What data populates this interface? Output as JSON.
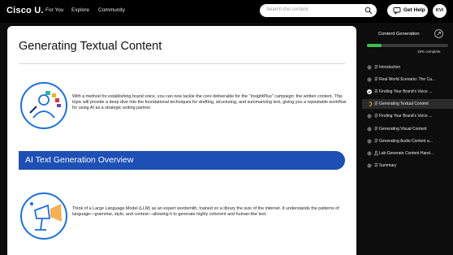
{
  "header": {
    "logo": {
      "brand": "Cisco",
      "suffix": "U."
    },
    "nav": [
      "For You",
      "Explore",
      "Community"
    ],
    "search_placeholder": "Search this content",
    "help_label": "Get Help",
    "avatar_initials": "KVI"
  },
  "main": {
    "title": "Generating Textual Content",
    "intro_text": "With a method for establishing brand voice, you can now tackle the core deliverable for the \"InsightPlus\" campaign: the written content. This topic will provide a deep dive into the foundational techniques for drafting, structuring, and summarizing text, giving you a repeatable workflow for using AI as a strategic writing partner.",
    "section_heading": "AI Text Generation Overview",
    "section_text": "Think of a Large Language Model (LLM) as an expert wordsmith, trained on a library the size of the internet. It understands the patterns of language—grammar, style, and context—allowing it to generate highly coherent and human-like text."
  },
  "sidebar": {
    "title": "Content Generation",
    "progress_percent": 18,
    "progress_label": "18% complete",
    "lessons": [
      {
        "label": "Introduction",
        "status": "not-started",
        "type": "lesson"
      },
      {
        "label": "Real World Scenario: The Ca...",
        "status": "not-started",
        "type": "lesson"
      },
      {
        "label": "Finding Your Brand's Voice ...",
        "status": "complete",
        "type": "lesson"
      },
      {
        "label": "Generating Textual Content",
        "status": "in-progress",
        "type": "lesson",
        "active": true
      },
      {
        "label": "Finding Your Brand's Voice ...",
        "status": "not-started",
        "type": "lesson"
      },
      {
        "label": "Generating Visual Content",
        "status": "not-started",
        "type": "lesson"
      },
      {
        "label": "Generating Audio Content a...",
        "status": "not-started",
        "type": "lesson"
      },
      {
        "label": "Lab:Generate Content Hand...",
        "status": "not-started",
        "type": "lab"
      },
      {
        "label": "Summary",
        "status": "not-started",
        "type": "lesson"
      }
    ]
  },
  "colors": {
    "accent_blue": "#1e4fb5",
    "progress_green": "#3fbf4a",
    "in_progress_yellow": "#f2d033",
    "background": "#0d0d0d"
  }
}
